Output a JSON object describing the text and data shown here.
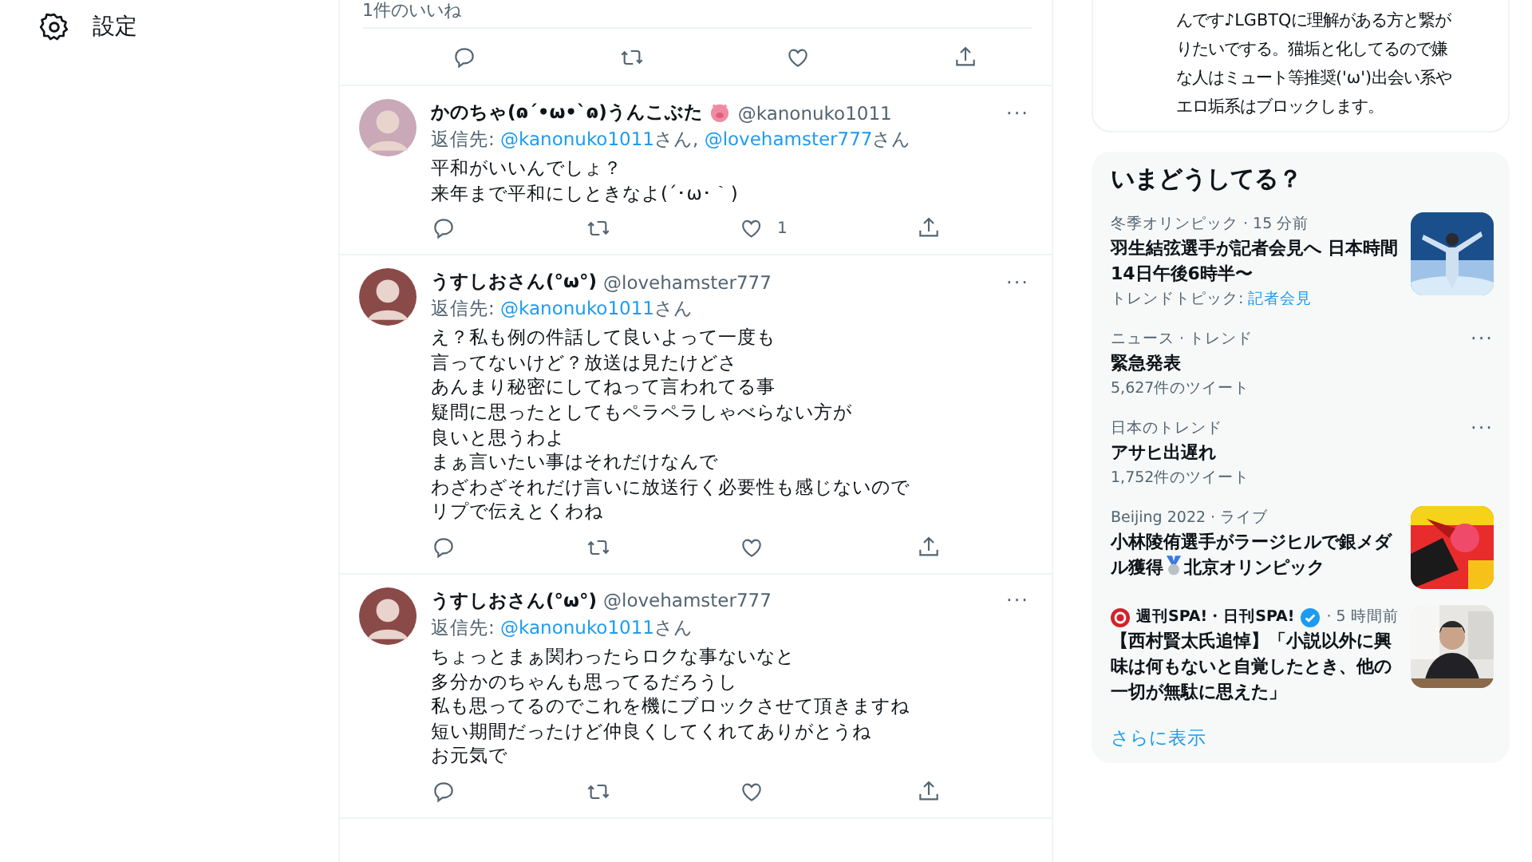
{
  "nav": {
    "settings_label": "設定"
  },
  "feed": {
    "prev_likes": "1件のいいね",
    "tweets": [
      {
        "name": "かのちゃ(ɷ´•ω•`ɷ)うんこぶた",
        "pig": true,
        "handle": "@kanonuko1011",
        "reply_prefix": "返信先:",
        "mentions": [
          {
            "handle": "@kanonuko1011",
            "suffix": "さん,"
          },
          {
            "handle": "@lovehamster777",
            "suffix": "さん"
          }
        ],
        "lines": [
          "平和がいいんでしょ？",
          "来年まで平和にしときなよ(´･ω･｀)"
        ],
        "like_count": "1",
        "more": "···"
      },
      {
        "name": "うすしおさん(°ω°)",
        "pig": false,
        "handle": "@lovehamster777",
        "reply_prefix": "返信先:",
        "mentions": [
          {
            "handle": "@kanonuko1011",
            "suffix": "さん"
          }
        ],
        "lines": [
          "え？私も例の件話して良いよって一度も",
          "言ってないけど？放送は見たけどさ",
          "あんまり秘密にしてねって言われてる事",
          "疑問に思ったとしてもペラペラしゃべらない方が",
          "良いと思うわよ",
          "まぁ言いたい事はそれだけなんで",
          "わざわざそれだけ言いに放送行く必要性も感じないので",
          "リプで伝えとくわね"
        ],
        "more": "···"
      },
      {
        "name": "うすしおさん(°ω°)",
        "pig": false,
        "handle": "@lovehamster777",
        "reply_prefix": "返信先:",
        "mentions": [
          {
            "handle": "@kanonuko1011",
            "suffix": "さん"
          }
        ],
        "lines": [
          "ちょっとまぁ関わったらロクな事ないなと",
          "多分かのちゃんも思ってるだろうし",
          "私も思ってるのでこれを機にブロックさせて頂きますね",
          "短い期間だったけど仲良くしてくれてありがとうね",
          "お元気で"
        ],
        "more": "···"
      }
    ]
  },
  "profile_bio": {
    "lines": [
      "んです♪LGBTQに理解がある方と繋が",
      "りたいでする。猫垢と化してるので嫌",
      "な人はミュート等推奨('ω')出会い系や",
      "エロ垢系はブロックします。"
    ]
  },
  "trends": {
    "title": "いまどうしてる？",
    "items": [
      {
        "meta": "冬季オリンピック · 15 分前",
        "title": "羽生結弦選手が記者会見へ 日本時間14日午後6時半〜",
        "topic_label": "トレンドトピック:",
        "topic_link": "記者会見"
      },
      {
        "kind": "menu",
        "meta": "ニュース · トレンド",
        "title": "緊急発表",
        "count": "5,627件のツイート",
        "more": "···"
      },
      {
        "kind": "menu",
        "meta": "日本のトレンド",
        "title": "アサヒ出遅れ",
        "count": "1,752件のツイート",
        "more": "···"
      },
      {
        "meta": "Beijing 2022 · ライブ",
        "title": "小林陵侑選手がラージヒルで銀メダル獲得",
        "medal": true,
        "title_after": "北京オリンピック"
      },
      {
        "source": {
          "name": "週刊SPA!・日刊SPA!",
          "verified": true,
          "time": "· 5 時間前"
        },
        "title": "【西村賢太氏追悼】「小説以外に興味は何もないと自覚したとき、他の一切が無駄に思えた」"
      }
    ],
    "show_more": "さらに表示"
  }
}
